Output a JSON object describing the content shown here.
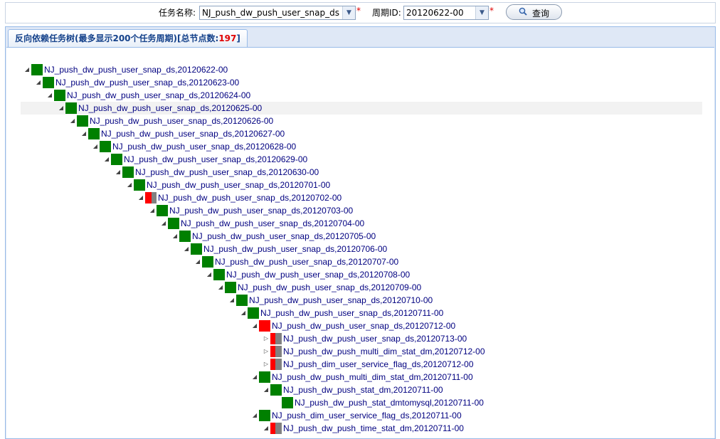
{
  "search": {
    "task_label": "任务名称:",
    "task_value": "NJ_push_dw_push_user_snap_ds",
    "period_label": "周期ID:",
    "period_value": "20120622-00",
    "required_mark": "*",
    "query_button": "查询"
  },
  "tab": {
    "title": "反向依赖任务树(最多显示200个任务周期)[总节点数:",
    "count": "197",
    "suffix": "]"
  },
  "status_colors": {
    "green": "#008000",
    "red": "#ff0000",
    "gray": "#808080",
    "link": "#000080",
    "highlight": "#f2f2f2"
  },
  "tree": [
    {
      "label": "NJ_push_dw_push_user_snap_ds,20120622-00",
      "depth": 0,
      "toggle": "expanded",
      "status": "green"
    },
    {
      "label": "NJ_push_dw_push_user_snap_ds,20120623-00",
      "depth": 1,
      "toggle": "expanded",
      "status": "green"
    },
    {
      "label": "NJ_push_dw_push_user_snap_ds,20120624-00",
      "depth": 2,
      "toggle": "expanded",
      "status": "green"
    },
    {
      "label": "NJ_push_dw_push_user_snap_ds,20120625-00",
      "depth": 3,
      "toggle": "expanded",
      "status": "green",
      "highlight": true
    },
    {
      "label": "NJ_push_dw_push_user_snap_ds,20120626-00",
      "depth": 4,
      "toggle": "expanded",
      "status": "green"
    },
    {
      "label": "NJ_push_dw_push_user_snap_ds,20120627-00",
      "depth": 5,
      "toggle": "expanded",
      "status": "green"
    },
    {
      "label": "NJ_push_dw_push_user_snap_ds,20120628-00",
      "depth": 6,
      "toggle": "expanded",
      "status": "green"
    },
    {
      "label": "NJ_push_dw_push_user_snap_ds,20120629-00",
      "depth": 7,
      "toggle": "expanded",
      "status": "green"
    },
    {
      "label": "NJ_push_dw_push_user_snap_ds,20120630-00",
      "depth": 8,
      "toggle": "expanded",
      "status": "green"
    },
    {
      "label": "NJ_push_dw_push_user_snap_ds,20120701-00",
      "depth": 9,
      "toggle": "expanded",
      "status": "green"
    },
    {
      "label": "NJ_push_dw_push_user_snap_ds,20120702-00",
      "depth": 10,
      "toggle": "expanded",
      "status": "redgray"
    },
    {
      "label": "NJ_push_dw_push_user_snap_ds,20120703-00",
      "depth": 11,
      "toggle": "expanded",
      "status": "green"
    },
    {
      "label": "NJ_push_dw_push_user_snap_ds,20120704-00",
      "depth": 12,
      "toggle": "expanded",
      "status": "green"
    },
    {
      "label": "NJ_push_dw_push_user_snap_ds,20120705-00",
      "depth": 13,
      "toggle": "expanded",
      "status": "green"
    },
    {
      "label": "NJ_push_dw_push_user_snap_ds,20120706-00",
      "depth": 14,
      "toggle": "expanded",
      "status": "green"
    },
    {
      "label": "NJ_push_dw_push_user_snap_ds,20120707-00",
      "depth": 15,
      "toggle": "expanded",
      "status": "green"
    },
    {
      "label": "NJ_push_dw_push_user_snap_ds,20120708-00",
      "depth": 16,
      "toggle": "expanded",
      "status": "green"
    },
    {
      "label": "NJ_push_dw_push_user_snap_ds,20120709-00",
      "depth": 17,
      "toggle": "expanded",
      "status": "green"
    },
    {
      "label": "NJ_push_dw_push_user_snap_ds,20120710-00",
      "depth": 18,
      "toggle": "expanded",
      "status": "green"
    },
    {
      "label": "NJ_push_dw_push_user_snap_ds,20120711-00",
      "depth": 19,
      "toggle": "expanded",
      "status": "green"
    },
    {
      "label": "NJ_push_dw_push_user_snap_ds,20120712-00",
      "depth": 20,
      "toggle": "expanded",
      "status": "red"
    },
    {
      "label": "NJ_push_dw_push_user_snap_ds,20120713-00",
      "depth": 21,
      "toggle": "collapsed",
      "status": "redgray2"
    },
    {
      "label": "NJ_push_dw_push_multi_dim_stat_dm,20120712-00",
      "depth": 21,
      "toggle": "collapsed",
      "status": "redgray2"
    },
    {
      "label": "NJ_push_dim_user_service_flag_ds,20120712-00",
      "depth": 21,
      "toggle": "collapsed",
      "status": "redgray2"
    },
    {
      "label": "NJ_push_dw_push_multi_dim_stat_dm,20120711-00",
      "depth": 20,
      "toggle": "expanded",
      "status": "green"
    },
    {
      "label": "NJ_push_dw_push_stat_dm,20120711-00",
      "depth": 21,
      "toggle": "expanded",
      "status": "green"
    },
    {
      "label": "NJ_push_dw_push_stat_dmtomysql,20120711-00",
      "depth": 22,
      "toggle": "none",
      "status": "green"
    },
    {
      "label": "NJ_push_dim_user_service_flag_ds,20120711-00",
      "depth": 20,
      "toggle": "expanded",
      "status": "green"
    },
    {
      "label": "NJ_push_dw_push_time_stat_dm,20120711-00",
      "depth": 21,
      "toggle": "expanded",
      "status": "redgray2"
    }
  ]
}
